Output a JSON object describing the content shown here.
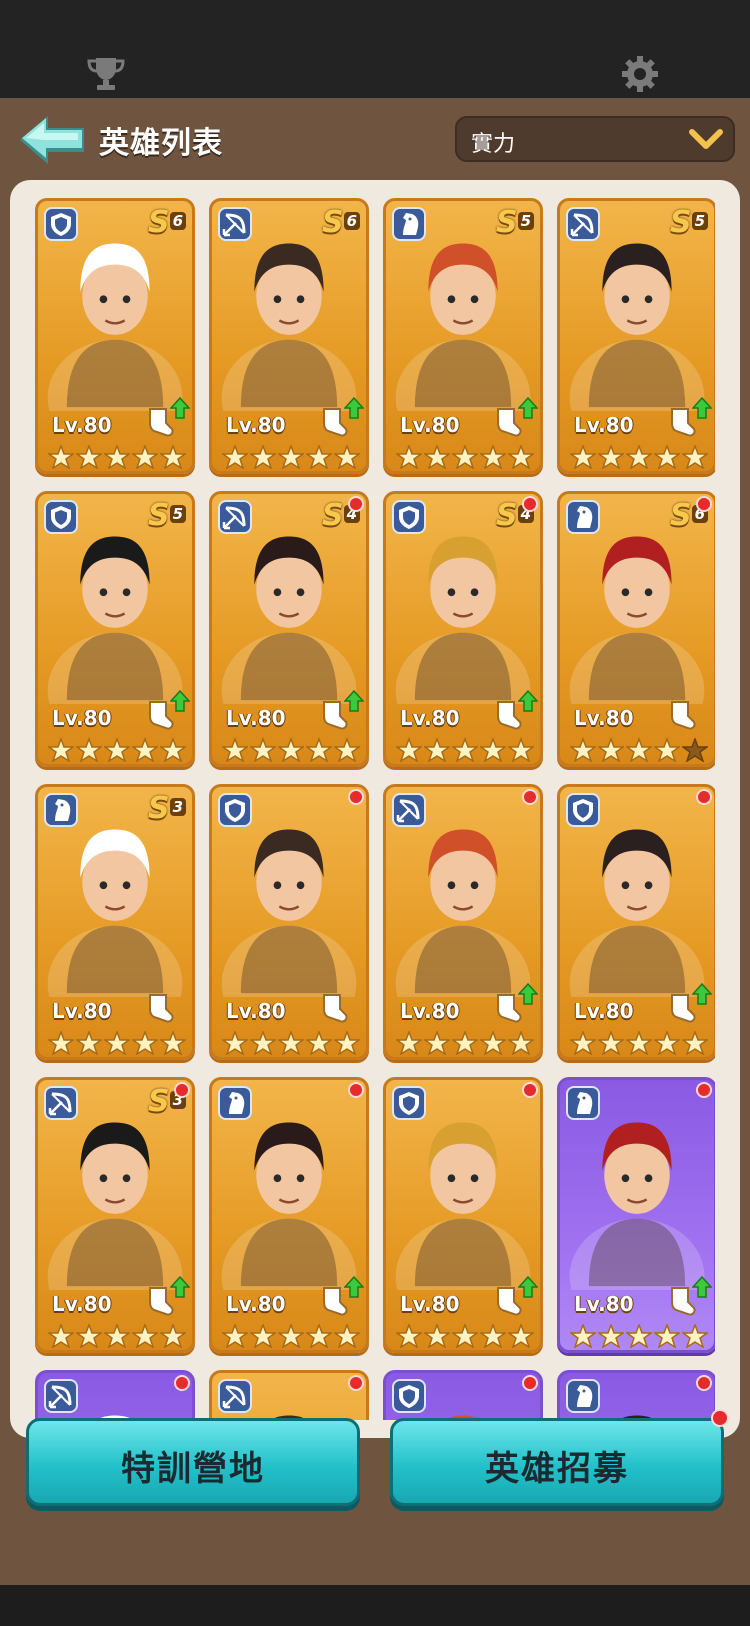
{
  "header": {
    "title": "英雄列表",
    "sort_value": "實力"
  },
  "icons": {
    "trophy": "trophy-icon",
    "settings": "gear-icon",
    "back": "back-arrow-icon"
  },
  "colors": {
    "card_gold": "#e59a24",
    "card_purple": "#a071f0",
    "accent_teal": "#23c1ca",
    "notify_red": "#e52b2b"
  },
  "heroes": [
    {
      "level": "Lv.80",
      "rank_letter": "S",
      "rank_num": "6",
      "class": "shield",
      "theme": "gold",
      "dot": false,
      "stars": 5,
      "upgrade": true
    },
    {
      "level": "Lv.80",
      "rank_letter": "S",
      "rank_num": "6",
      "class": "bow",
      "theme": "gold",
      "dot": false,
      "stars": 5,
      "upgrade": true
    },
    {
      "level": "Lv.80",
      "rank_letter": "S",
      "rank_num": "5",
      "class": "horse",
      "theme": "gold",
      "dot": false,
      "stars": 5,
      "upgrade": true
    },
    {
      "level": "Lv.80",
      "rank_letter": "S",
      "rank_num": "5",
      "class": "bow",
      "theme": "gold",
      "dot": false,
      "stars": 5,
      "upgrade": true
    },
    {
      "level": "Lv.80",
      "rank_letter": "S",
      "rank_num": "5",
      "class": "shield",
      "theme": "gold",
      "dot": false,
      "stars": 5,
      "upgrade": true
    },
    {
      "level": "Lv.80",
      "rank_letter": "S",
      "rank_num": "4",
      "class": "bow",
      "theme": "gold",
      "dot": true,
      "stars": 5,
      "upgrade": true
    },
    {
      "level": "Lv.80",
      "rank_letter": "S",
      "rank_num": "4",
      "class": "shield",
      "theme": "gold",
      "dot": true,
      "stars": 5,
      "upgrade": true
    },
    {
      "level": "Lv.80",
      "rank_letter": "S",
      "rank_num": "6",
      "class": "horse",
      "theme": "gold",
      "dot": true,
      "stars": 4,
      "upgrade": false
    },
    {
      "level": "Lv.80",
      "rank_letter": "S",
      "rank_num": "3",
      "class": "horse",
      "theme": "gold",
      "dot": false,
      "stars": 5,
      "upgrade": false
    },
    {
      "level": "Lv.80",
      "rank_letter": "",
      "rank_num": "",
      "class": "shield",
      "theme": "gold",
      "dot": true,
      "stars": 5,
      "upgrade": false
    },
    {
      "level": "Lv.80",
      "rank_letter": "",
      "rank_num": "",
      "class": "bow",
      "theme": "gold",
      "dot": true,
      "stars": 5,
      "upgrade": true
    },
    {
      "level": "Lv.80",
      "rank_letter": "",
      "rank_num": "",
      "class": "shield",
      "theme": "gold",
      "dot": true,
      "stars": 5,
      "upgrade": true
    },
    {
      "level": "Lv.80",
      "rank_letter": "S",
      "rank_num": "3",
      "class": "bow",
      "theme": "gold",
      "dot": true,
      "stars": 5,
      "upgrade": true
    },
    {
      "level": "Lv.80",
      "rank_letter": "",
      "rank_num": "",
      "class": "horse",
      "theme": "gold",
      "dot": true,
      "stars": 5,
      "upgrade": true
    },
    {
      "level": "Lv.80",
      "rank_letter": "",
      "rank_num": "",
      "class": "shield",
      "theme": "gold",
      "dot": true,
      "stars": 5,
      "upgrade": true
    },
    {
      "level": "Lv.80",
      "rank_letter": "",
      "rank_num": "",
      "class": "horse",
      "theme": "purple",
      "dot": true,
      "stars": 5,
      "upgrade": true
    },
    {
      "level": "",
      "rank_letter": "",
      "rank_num": "",
      "class": "bow",
      "theme": "purple",
      "dot": true,
      "stars": 0,
      "upgrade": false
    },
    {
      "level": "",
      "rank_letter": "",
      "rank_num": "",
      "class": "bow",
      "theme": "gold",
      "dot": true,
      "stars": 0,
      "upgrade": false
    },
    {
      "level": "",
      "rank_letter": "",
      "rank_num": "",
      "class": "shield",
      "theme": "purple",
      "dot": true,
      "stars": 0,
      "upgrade": false
    },
    {
      "level": "",
      "rank_letter": "",
      "rank_num": "",
      "class": "horse",
      "theme": "purple",
      "dot": true,
      "stars": 0,
      "upgrade": false
    }
  ],
  "buttons": {
    "training": "特訓營地",
    "recruit": "英雄招募"
  }
}
